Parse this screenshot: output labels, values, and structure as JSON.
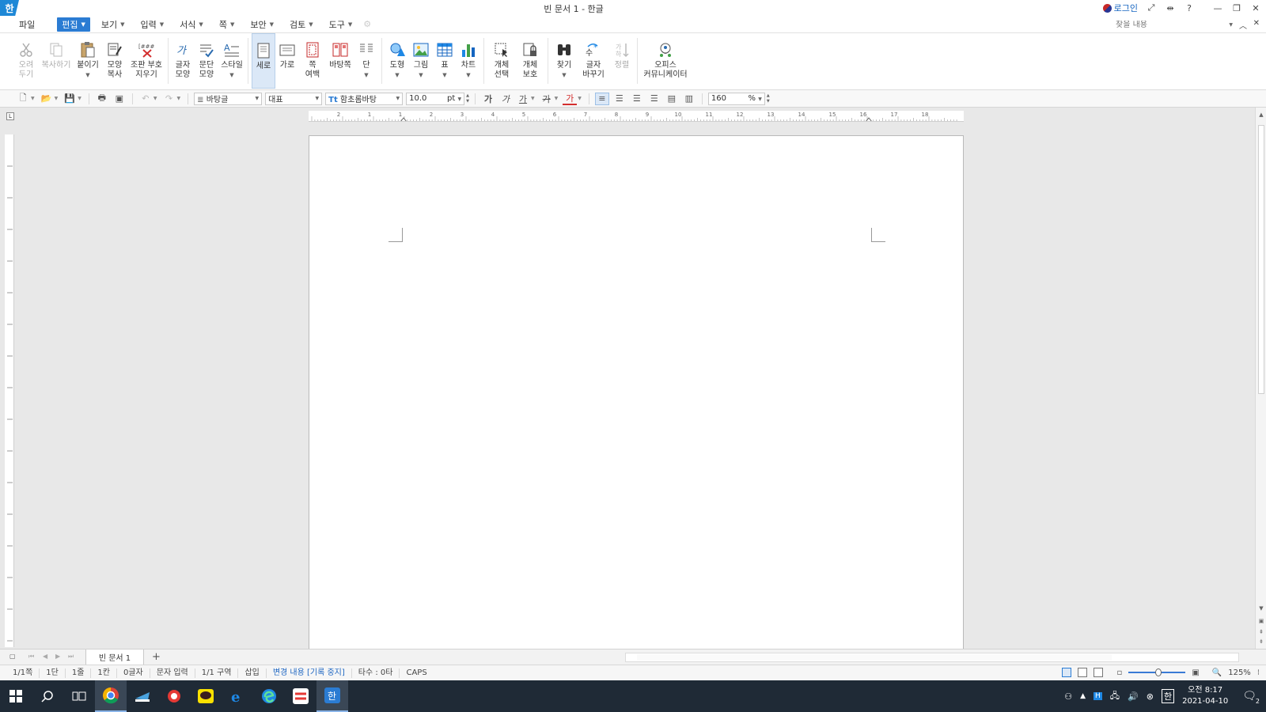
{
  "window": {
    "title": "빈 문서 1 - 한글",
    "logo_text": "한",
    "login_label": "로그인"
  },
  "menu": {
    "items": [
      {
        "label": "파일",
        "dropdown": false
      },
      {
        "label": "편집",
        "dropdown": true,
        "active": true
      },
      {
        "label": "보기",
        "dropdown": true
      },
      {
        "label": "입력",
        "dropdown": true
      },
      {
        "label": "서식",
        "dropdown": true
      },
      {
        "label": "쪽",
        "dropdown": true
      },
      {
        "label": "보안",
        "dropdown": true
      },
      {
        "label": "검토",
        "dropdown": true
      },
      {
        "label": "도구",
        "dropdown": true
      }
    ],
    "search_placeholder": "찾을 내용"
  },
  "ribbon": {
    "cut": {
      "line1": "오려",
      "line2": "두기"
    },
    "copy": {
      "line1": "복사하기"
    },
    "paste": {
      "line1": "붙이기"
    },
    "format_copy": {
      "line1": "모양",
      "line2": "복사"
    },
    "clear_marks": {
      "line1": "조판 부호",
      "line2": "지우기"
    },
    "char_shape": {
      "line1": "글자",
      "line2": "모양"
    },
    "para_shape": {
      "line1": "문단",
      "line2": "모양"
    },
    "style": {
      "line1": "스타일"
    },
    "portrait": {
      "line1": "세로"
    },
    "landscape": {
      "line1": "가로"
    },
    "margin": {
      "line1": "쪽",
      "line2": "여백"
    },
    "background": {
      "line1": "바탕쪽"
    },
    "columns": {
      "line1": "단"
    },
    "shape": {
      "line1": "도형"
    },
    "picture": {
      "line1": "그림"
    },
    "table": {
      "line1": "표"
    },
    "chart": {
      "line1": "차트"
    },
    "obj_select": {
      "line1": "개체",
      "line2": "선택"
    },
    "obj_protect": {
      "line1": "개체",
      "line2": "보호"
    },
    "find": {
      "line1": "찾기"
    },
    "replace": {
      "line1": "글자",
      "line2": "바꾸기"
    },
    "sort": {
      "line1": "정렬"
    },
    "office": {
      "line1": "오피스",
      "line2": "커뮤니케이터"
    }
  },
  "format": {
    "style_value": "바탕글",
    "lang_value": "대표",
    "font_value": "함초롬바탕",
    "size_value": "10.0",
    "size_unit": "pt",
    "bold": "가",
    "italic": "가",
    "underline": "가",
    "strike": "가",
    "color": "가",
    "zoom_value": "160",
    "zoom_unit": "%",
    "font_prefix": "Tt"
  },
  "ruler": {
    "h_ticks": [
      "2",
      "1",
      "1",
      "2",
      "3",
      "4",
      "5",
      "6",
      "7",
      "8",
      "9",
      "10",
      "11",
      "12",
      "13",
      "14",
      "15",
      "16",
      "17",
      "18"
    ]
  },
  "tabs": {
    "doc_tab": "빈 문서 1",
    "add": "+"
  },
  "status": {
    "items": [
      "1/1쪽",
      "1단",
      "1줄",
      "1칸",
      "0글자",
      "문자 입력",
      "1/1 구역",
      "삽입",
      "변경 내용 [기록 중지]",
      "타수 : 0타",
      "CAPS"
    ],
    "zoom": "125%"
  },
  "taskbar": {
    "time": "오전 8:17",
    "date": "2021-04-10",
    "notif_count": "2",
    "ime_label": "한"
  }
}
